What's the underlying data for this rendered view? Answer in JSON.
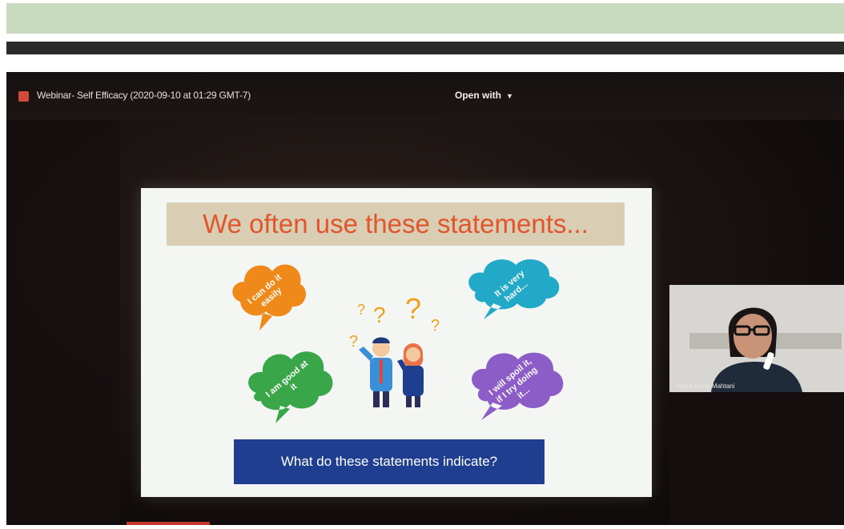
{
  "viewer": {
    "title": "Webinar- Self Efficacy (2020-09-10 at 01:29 GMT-7)",
    "open_with_label": "Open with",
    "icon": "document-icon"
  },
  "slide": {
    "title": "We often use these statements...",
    "bubbles": [
      {
        "text": "I can do it easily",
        "color": "#ef8a1a"
      },
      {
        "text": "It is very hard...",
        "color": "#22a9c7"
      },
      {
        "text": "I am good at it",
        "color": "#3aa64a"
      },
      {
        "text": "I will spoil it, if I try doing it...",
        "color": "#8c5cc7"
      }
    ],
    "question": "What do these statements indicate?"
  },
  "participant": {
    "name": "Amita Pavia Mahtani"
  },
  "colors": {
    "top_band": "#c9dbbf",
    "question_box": "#1f3e8f",
    "title_text": "#e0552b"
  }
}
